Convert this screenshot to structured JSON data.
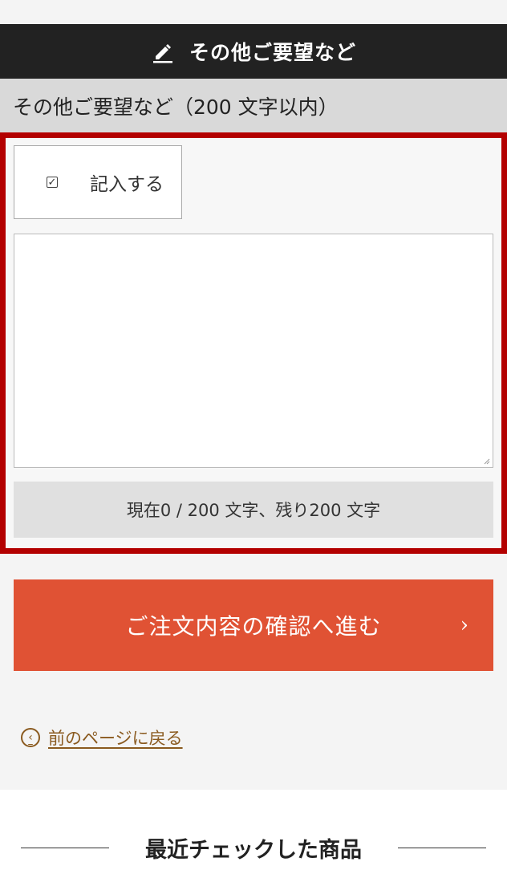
{
  "header": {
    "title": "その他ご要望など",
    "icon": "pencil-icon"
  },
  "section": {
    "label": "その他ご要望など（200 文字以内）"
  },
  "form": {
    "checkbox_label": "記入する",
    "checkbox_checked": true,
    "textarea_value": "",
    "counter_text": "現在0 / 200 文字、残り200 文字"
  },
  "actions": {
    "confirm_label": "ご注文内容の確認へ進む",
    "back_label": "前のページに戻る"
  },
  "recent": {
    "title": "最近チェックした商品"
  },
  "colors": {
    "header_bg": "#222222",
    "accent_red_border": "#b30000",
    "confirm_bg": "#e05234",
    "link_brown": "#8a5a1f"
  }
}
